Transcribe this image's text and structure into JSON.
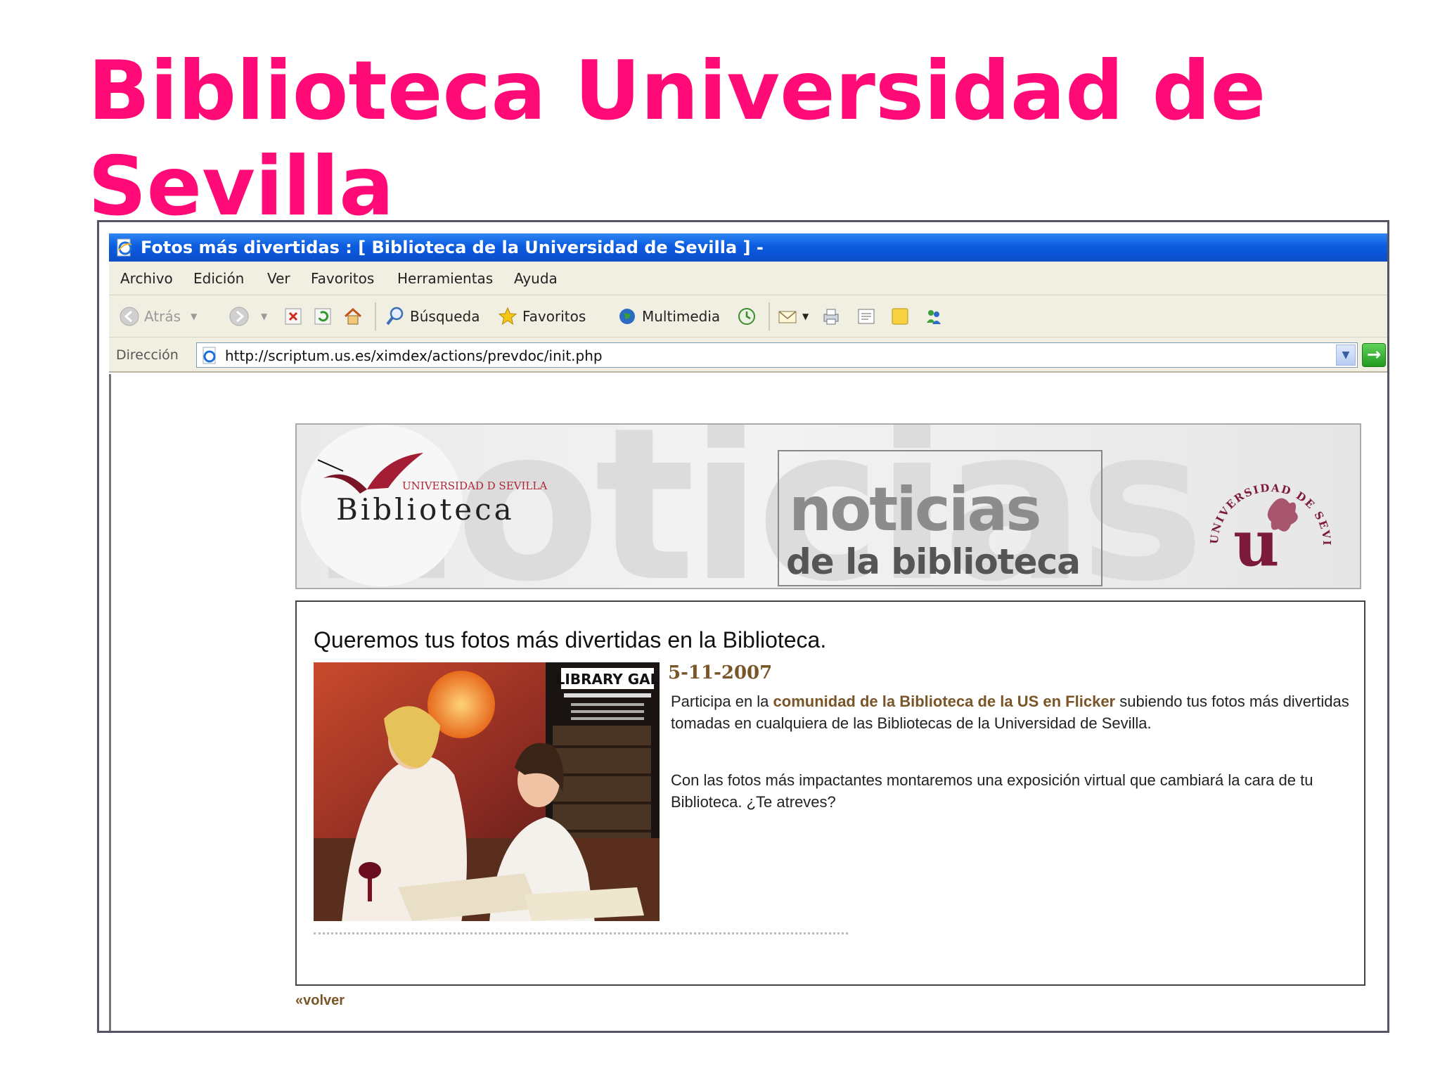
{
  "slide": {
    "title": "Biblioteca Universidad de Sevilla"
  },
  "window": {
    "title": "Fotos más divertidas : [ Biblioteca de la Universidad de Sevilla ] -"
  },
  "menu": [
    "Archivo",
    "Edición",
    "Ver",
    "Favoritos",
    "Herramientas",
    "Ayuda"
  ],
  "toolbar": {
    "back": "Atrás",
    "search": "Búsqueda",
    "favorites": "Favoritos",
    "media": "Multimedia"
  },
  "address": {
    "label": "Dirección",
    "url": "http://scriptum.us.es/ximdex/actions/prevdoc/init.php"
  },
  "banner": {
    "logo_small": "UNIVERSIDAD D SEVILLA",
    "logo_name": "Biblioteca",
    "bg_word": "noticias",
    "noticias_word": "noticias",
    "noticias_sub": "de la biblioteca",
    "seal_text": "UNIVERSIDAD DE SEVILLA",
    "seal_letter": "u"
  },
  "article": {
    "title": "Queremos tus fotos más divertidas en la Biblioteca.",
    "date": "5-11-2007",
    "para1_before": "Participa en la ",
    "para1_link": "comunidad de la Biblioteca de la US en Flicker",
    "para1_after": " subiendo tus fotos más divertidas tomadas en cualquiera de las Bibliotecas de la Universidad de Sevilla.",
    "para2": "Con las fotos más impactantes montaremos una exposición virtual que cambiará la cara de tu Biblioteca. ¿Te atreves?",
    "photo_caption": "LIBRARY GAL"
  },
  "footer": {
    "back_link": "volver"
  },
  "colors": {
    "title_pink": "#ff0a76",
    "xp_blue": "#0a53d3",
    "link_brown": "#7a5528",
    "seal_maroon": "#7d1a3a"
  }
}
